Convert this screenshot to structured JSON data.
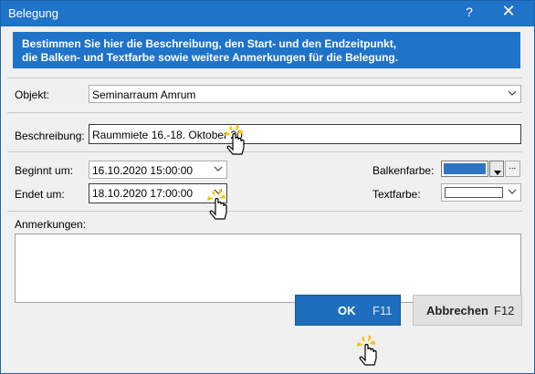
{
  "window": {
    "title": "Belegung",
    "help": "?",
    "close": "✕"
  },
  "header": {
    "line1": "Bestimmen Sie hier die Beschreibung, den Start- und den Endzeitpunkt,",
    "line2": "die Balken- und Textfarbe sowie weitere Anmerkungen für die Belegung."
  },
  "objekt": {
    "label": "Objekt:",
    "value": "Seminarraum Amrum"
  },
  "beschreibung": {
    "label": "Beschreibung:",
    "value": "Raummiete 16.-18. Oktober 20"
  },
  "beginnt": {
    "label": "Beginnt um:",
    "value": "16.10.2020 15:00:00"
  },
  "endet": {
    "label": "Endet um:",
    "value": "18.10.2020 17:00:00"
  },
  "balkenfarbe": {
    "label": "Balkenfarbe:",
    "color": "#2f73c4",
    "more": "..."
  },
  "textfarbe": {
    "label": "Textfarbe:",
    "color": "#ffffff"
  },
  "anmerkungen": {
    "label": "Anmerkungen:",
    "value": ""
  },
  "buttons": {
    "ok_label": "OK",
    "ok_key": "F11",
    "cancel_label": "Abbrechen",
    "cancel_key": "F12"
  },
  "colors": {
    "accent": "#1f73c8",
    "button_primary": "#1f6ebe"
  }
}
